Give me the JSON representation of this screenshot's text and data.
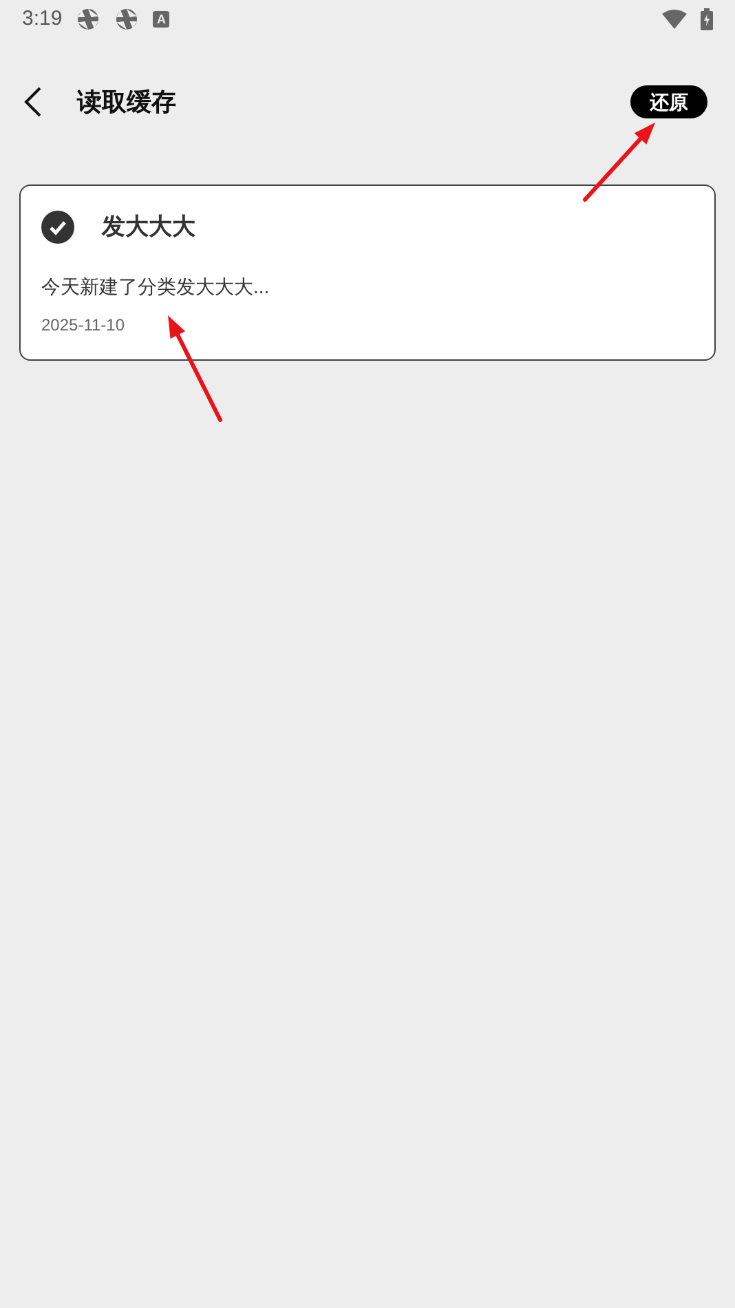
{
  "status_bar": {
    "time": "3:19",
    "notification_letter": "A"
  },
  "header": {
    "title": "读取缓存",
    "action": "还原"
  },
  "cards": [
    {
      "title": "发大大大",
      "checked": true,
      "preview": "今天新建了分类发大大大...",
      "date": "2025-11-10"
    }
  ]
}
